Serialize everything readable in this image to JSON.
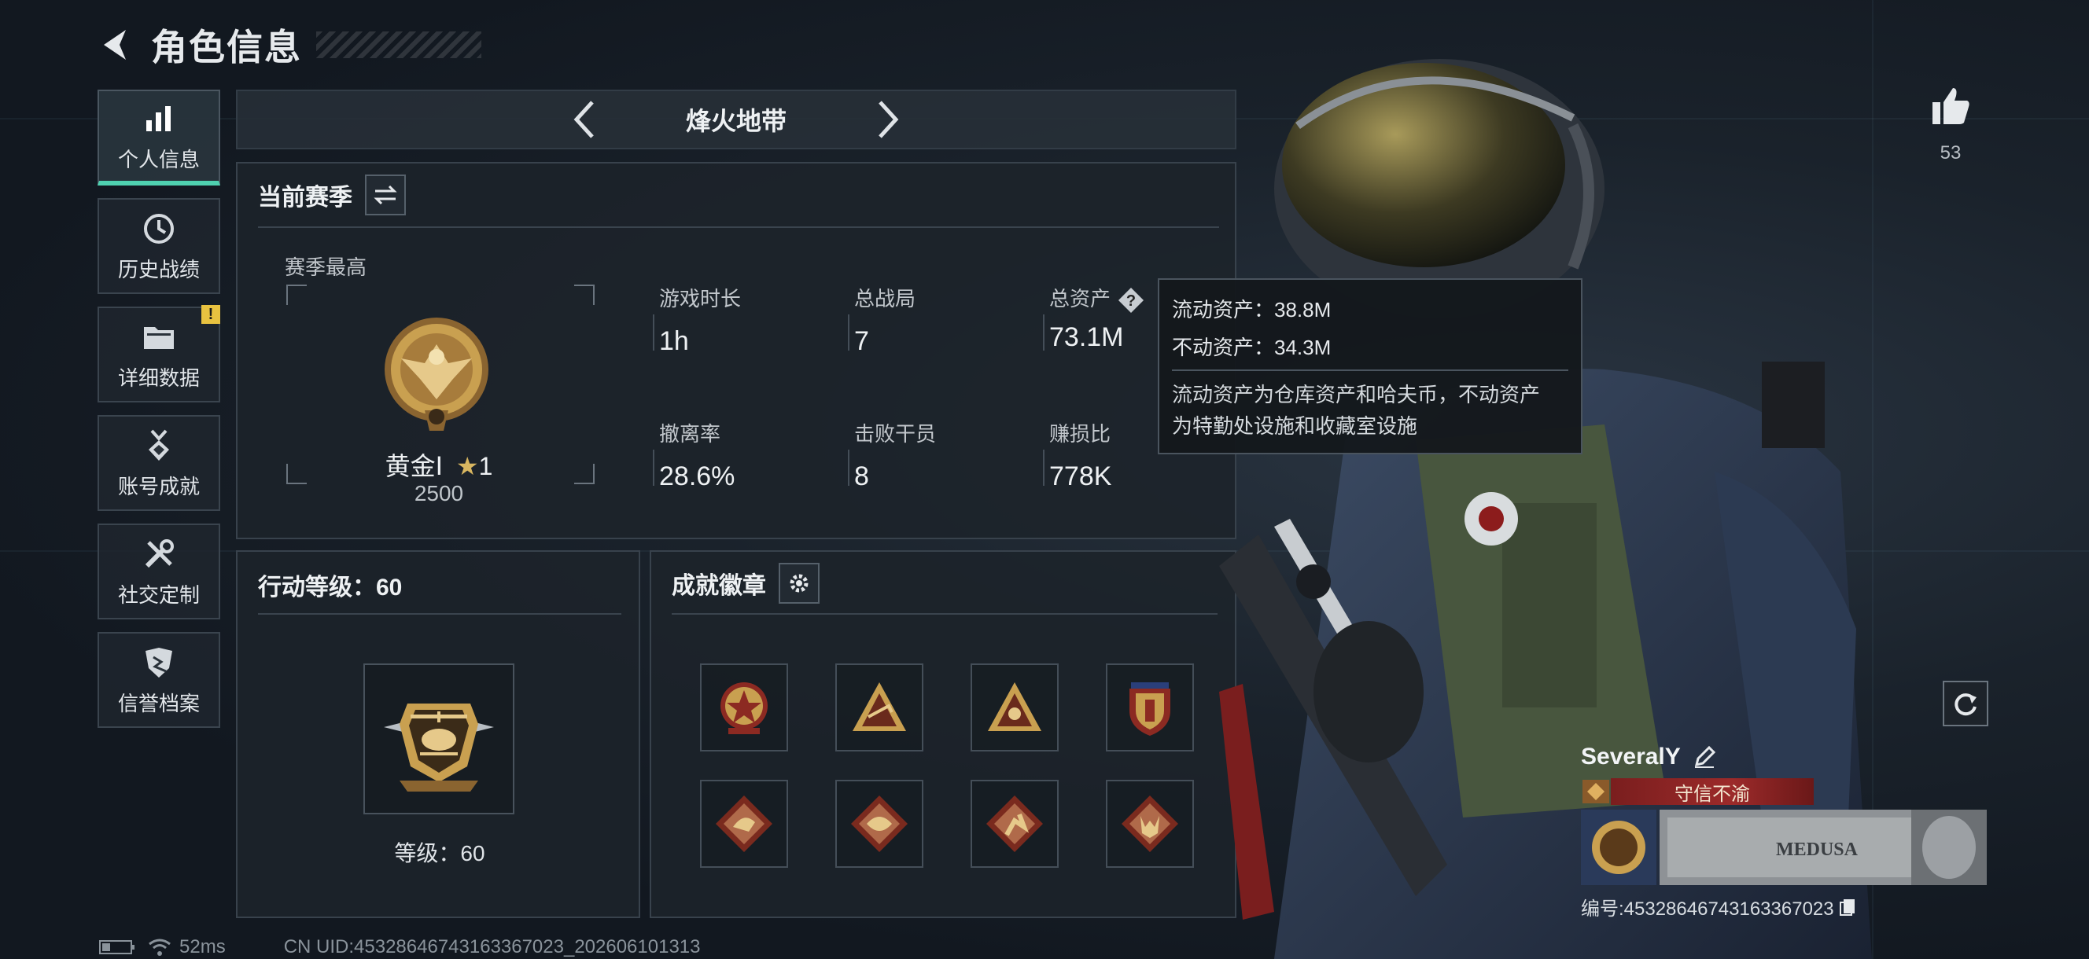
{
  "header": {
    "title": "角色信息"
  },
  "sidebar": {
    "items": [
      {
        "label": "个人信息",
        "icon": "bar-chart-icon",
        "active": true
      },
      {
        "label": "历史战绩",
        "icon": "clock-icon"
      },
      {
        "label": "详细数据",
        "icon": "folder-icon",
        "alert": "!"
      },
      {
        "label": "账号成就",
        "icon": "medal-icon"
      },
      {
        "label": "社交定制",
        "icon": "tools-icon"
      },
      {
        "label": "信誉档案",
        "icon": "shield-icon"
      }
    ]
  },
  "mode": {
    "name": "烽火地带"
  },
  "season": {
    "title": "当前赛季",
    "best_label": "赛季最高",
    "rank_name": "黄金Ⅰ",
    "rank_stars": "1",
    "rank_score": "2500",
    "stats": [
      {
        "label": "游戏时长",
        "value": "1h"
      },
      {
        "label": "总战局",
        "value": "7"
      },
      {
        "label": "总资产",
        "value": "73.1M"
      },
      {
        "label": "撤离率",
        "value": "28.6%"
      },
      {
        "label": "击败干员",
        "value": "8"
      },
      {
        "label": "赚损比",
        "value": "778K"
      }
    ]
  },
  "tooltip": {
    "liquid": "流动资产：38.8M",
    "fixed": "不动资产：34.3M",
    "desc1": "流动资产为仓库资产和哈夫币，不动资产",
    "desc2": "为特勤处设施和收藏室设施"
  },
  "level": {
    "title": "行动等级：60",
    "text": "等级：60"
  },
  "achievements": {
    "title": "成就徽章"
  },
  "likes": {
    "count": "53"
  },
  "player": {
    "name": "SeveralY",
    "honor": "守信不渝",
    "banner_text": "MEDUSA",
    "uid": "编号:45328646743163367023"
  },
  "status": {
    "ping": "52ms",
    "uid": "CN UID:45328646743163367023_202606101313"
  },
  "colors": {
    "accent": "#4fd1b0",
    "gold": "#c9a050",
    "honor_red": "#9c2a2a"
  }
}
